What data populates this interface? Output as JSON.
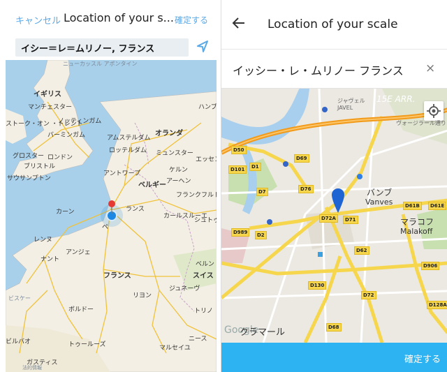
{
  "left": {
    "cancel_label": "キャンセル",
    "title": "Location of your s...",
    "confirm_label": "確定する",
    "search_value": "イシー＝レ＝ムリノー, フランス",
    "locate_icon": "navigation-arrow-icon",
    "map_labels": {
      "l1": "ニューカッスル\nアポンタイン",
      "l2": "イギリス",
      "l3": "マンチェスター",
      "l4": "ノッティンガム",
      "l5": "ストーク・オン\n・トレント",
      "l6": "バーミンガム",
      "l7": "オランダ",
      "l8": "アムステルダム",
      "l9": "ロッテルダム",
      "l10": "ミュンスター",
      "l11": "グロスター",
      "l12": "ロンドン",
      "l13": "ブリストル",
      "l14": "サウサンプトン",
      "l15": "アントワープ",
      "l16": "ケルン",
      "l17": "エッセン",
      "l18": "ベルギー",
      "l19": "アーヘン",
      "l20": "フランクフルト・\nアム・マイン",
      "l21": "カーン",
      "l22": "ランス",
      "l23": "カールスルーエ",
      "l24": "シュトゥッ\nトガルト",
      "l25": "レンヌ",
      "l26": "ナント",
      "l27": "アンジェ",
      "l28": "フランス",
      "l29": "ベルン",
      "l30": "スイス",
      "l31": "リヨン",
      "l32": "ジュネーヴ",
      "l33": "ボルドー",
      "l34": "ビルバオ",
      "l35": "トゥールーズ",
      "l36": "マルセイユ",
      "l37": "ニース",
      "l38": "ガスティス",
      "l39": "ハンブ",
      "l40": "ビスケー",
      "l41": "トリノ",
      "l42": "ペ"
    },
    "attribution": "法的情報"
  },
  "right": {
    "back_icon": "arrow-left-icon",
    "title": "Location of your scale",
    "search_value": "イッシー・レ・ムリノー フランス",
    "clear_label": "×",
    "gps_icon": "crosshair-icon",
    "map_labels": {
      "vanves_jp": "バンブ",
      "vanves": "Vanves",
      "malakoff_jp": "マラコフ",
      "malakoff": "Malakoff",
      "arr": "15E ARR.",
      "javel": "ジャヴェル\nJAVEL",
      "google": "Google",
      "clamart": "クラマール",
      "boulevard": "ヴォージラール通り"
    },
    "road_labels": {
      "d50": "D50",
      "d1": "D1",
      "d101": "D101",
      "d69": "D69",
      "d7": "D7",
      "d76": "D76",
      "d72a": "D72A",
      "d71": "D71",
      "d61b": "D61B",
      "d61e": "D61E",
      "d989": "D989",
      "d2": "D2",
      "d62": "D62",
      "d130": "D130",
      "d72": "D72",
      "d906": "D906",
      "d128a": "D128A",
      "d68": "D68"
    },
    "confirm_label": "確定する"
  },
  "colors": {
    "accent": "#2db3f2",
    "link": "#5aa9e6",
    "pin_red": "#e53935",
    "pin_blue": "#1e88e5"
  }
}
